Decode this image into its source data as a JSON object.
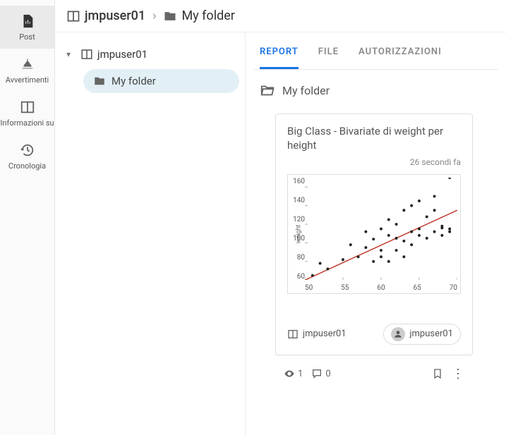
{
  "leftRail": {
    "items": [
      {
        "label": "Post"
      },
      {
        "label": "Avvertimenti"
      },
      {
        "label": "Informazioni su"
      },
      {
        "label": "Cronologia"
      }
    ]
  },
  "breadcrumb": {
    "root": "jmpuser01",
    "folder": "My folder"
  },
  "tree": {
    "root": "jmpuser01",
    "child": "My folder"
  },
  "tabs": {
    "report": "REPORT",
    "file": "FILE",
    "auth": "AUTORIZZAZIONI"
  },
  "folderTitle": "My folder",
  "card": {
    "title": "Big Class - Bivariate di weight per height",
    "time": "26 secondi fa",
    "owner": "jmpuser01",
    "chipUser": "jmpuser01"
  },
  "stats": {
    "views": "1",
    "comments": "0"
  },
  "chart_data": {
    "type": "scatter",
    "xlabel": "",
    "ylabel": "weight",
    "xlim": [
      50,
      70
    ],
    "ylim": [
      60,
      170
    ],
    "xticks": [
      50,
      55,
      60,
      65,
      70
    ],
    "yticks": [
      60,
      80,
      100,
      120,
      140,
      160
    ],
    "fit_line": {
      "x1": 50,
      "y1": 60,
      "x2": 70,
      "y2": 135
    },
    "points": [
      [
        51,
        65
      ],
      [
        52,
        78
      ],
      [
        53,
        72
      ],
      [
        55,
        82
      ],
      [
        56,
        98
      ],
      [
        57,
        85
      ],
      [
        58,
        95
      ],
      [
        58,
        112
      ],
      [
        59,
        80
      ],
      [
        59,
        104
      ],
      [
        60,
        85
      ],
      [
        60,
        92
      ],
      [
        60,
        115
      ],
      [
        61,
        80
      ],
      [
        61,
        108
      ],
      [
        61,
        125
      ],
      [
        62,
        105
      ],
      [
        62,
        120
      ],
      [
        62,
        92
      ],
      [
        63,
        85
      ],
      [
        63,
        102
      ],
      [
        63,
        135
      ],
      [
        64,
        98
      ],
      [
        64,
        112
      ],
      [
        64,
        140
      ],
      [
        65,
        108
      ],
      [
        65,
        115
      ],
      [
        65,
        145
      ],
      [
        66,
        105
      ],
      [
        66,
        128
      ],
      [
        67,
        112
      ],
      [
        67,
        135
      ],
      [
        67,
        150
      ],
      [
        68,
        108
      ],
      [
        68,
        118
      ],
      [
        68,
        116
      ],
      [
        69,
        115
      ],
      [
        69,
        112
      ],
      [
        69,
        170
      ]
    ]
  }
}
